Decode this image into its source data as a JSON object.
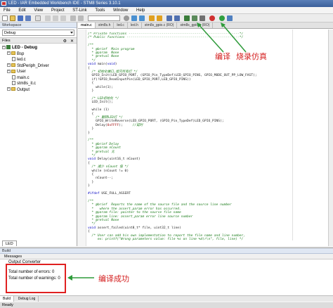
{
  "window": {
    "title": "LED - IAR Embedded Workbench IDE - STM8 Series 3.10.1"
  },
  "menu": [
    "File",
    "Edit",
    "View",
    "Project",
    "ST-Link",
    "Tools",
    "Window",
    "Help"
  ],
  "workspace": {
    "header": "Workspace",
    "config": "Debug",
    "files_label": "Files",
    "tree": [
      {
        "label": "LED - Debug",
        "kind": "project",
        "indent": 0
      },
      {
        "label": "Bsp",
        "kind": "folder",
        "indent": 1
      },
      {
        "label": "led.c",
        "kind": "file",
        "indent": 2
      },
      {
        "label": "StdPeriph_Driver",
        "kind": "folder",
        "indent": 1
      },
      {
        "label": "User",
        "kind": "folder",
        "indent": 1
      },
      {
        "label": "main.c",
        "kind": "file",
        "indent": 2
      },
      {
        "label": "stm8s_it.c",
        "kind": "file",
        "indent": 2
      },
      {
        "label": "Output",
        "kind": "folder",
        "indent": 1
      }
    ],
    "tab": "LED"
  },
  "editor": {
    "tabs": [
      "main.c",
      "stm8s.h",
      "led.c",
      "led.h",
      "stm8s_gpio.c (RO)",
      "stm8s_gpio.h (RO)"
    ],
    "active_tab": 0
  },
  "build": {
    "header": "Build",
    "messages_label": "Messages",
    "lines": [
      "Output Converter",
      "",
      "Total number of errors: 0",
      "Total number of warnings: 0"
    ],
    "tabs": [
      "Build",
      "Debug Log"
    ]
  },
  "status": "Ready",
  "annotations": {
    "compile": "编译",
    "download_debug": "烧录仿真",
    "compile_success": "编译成功"
  },
  "colors": {
    "annotation": "#d42020",
    "arrow": "#2e9b3a"
  }
}
